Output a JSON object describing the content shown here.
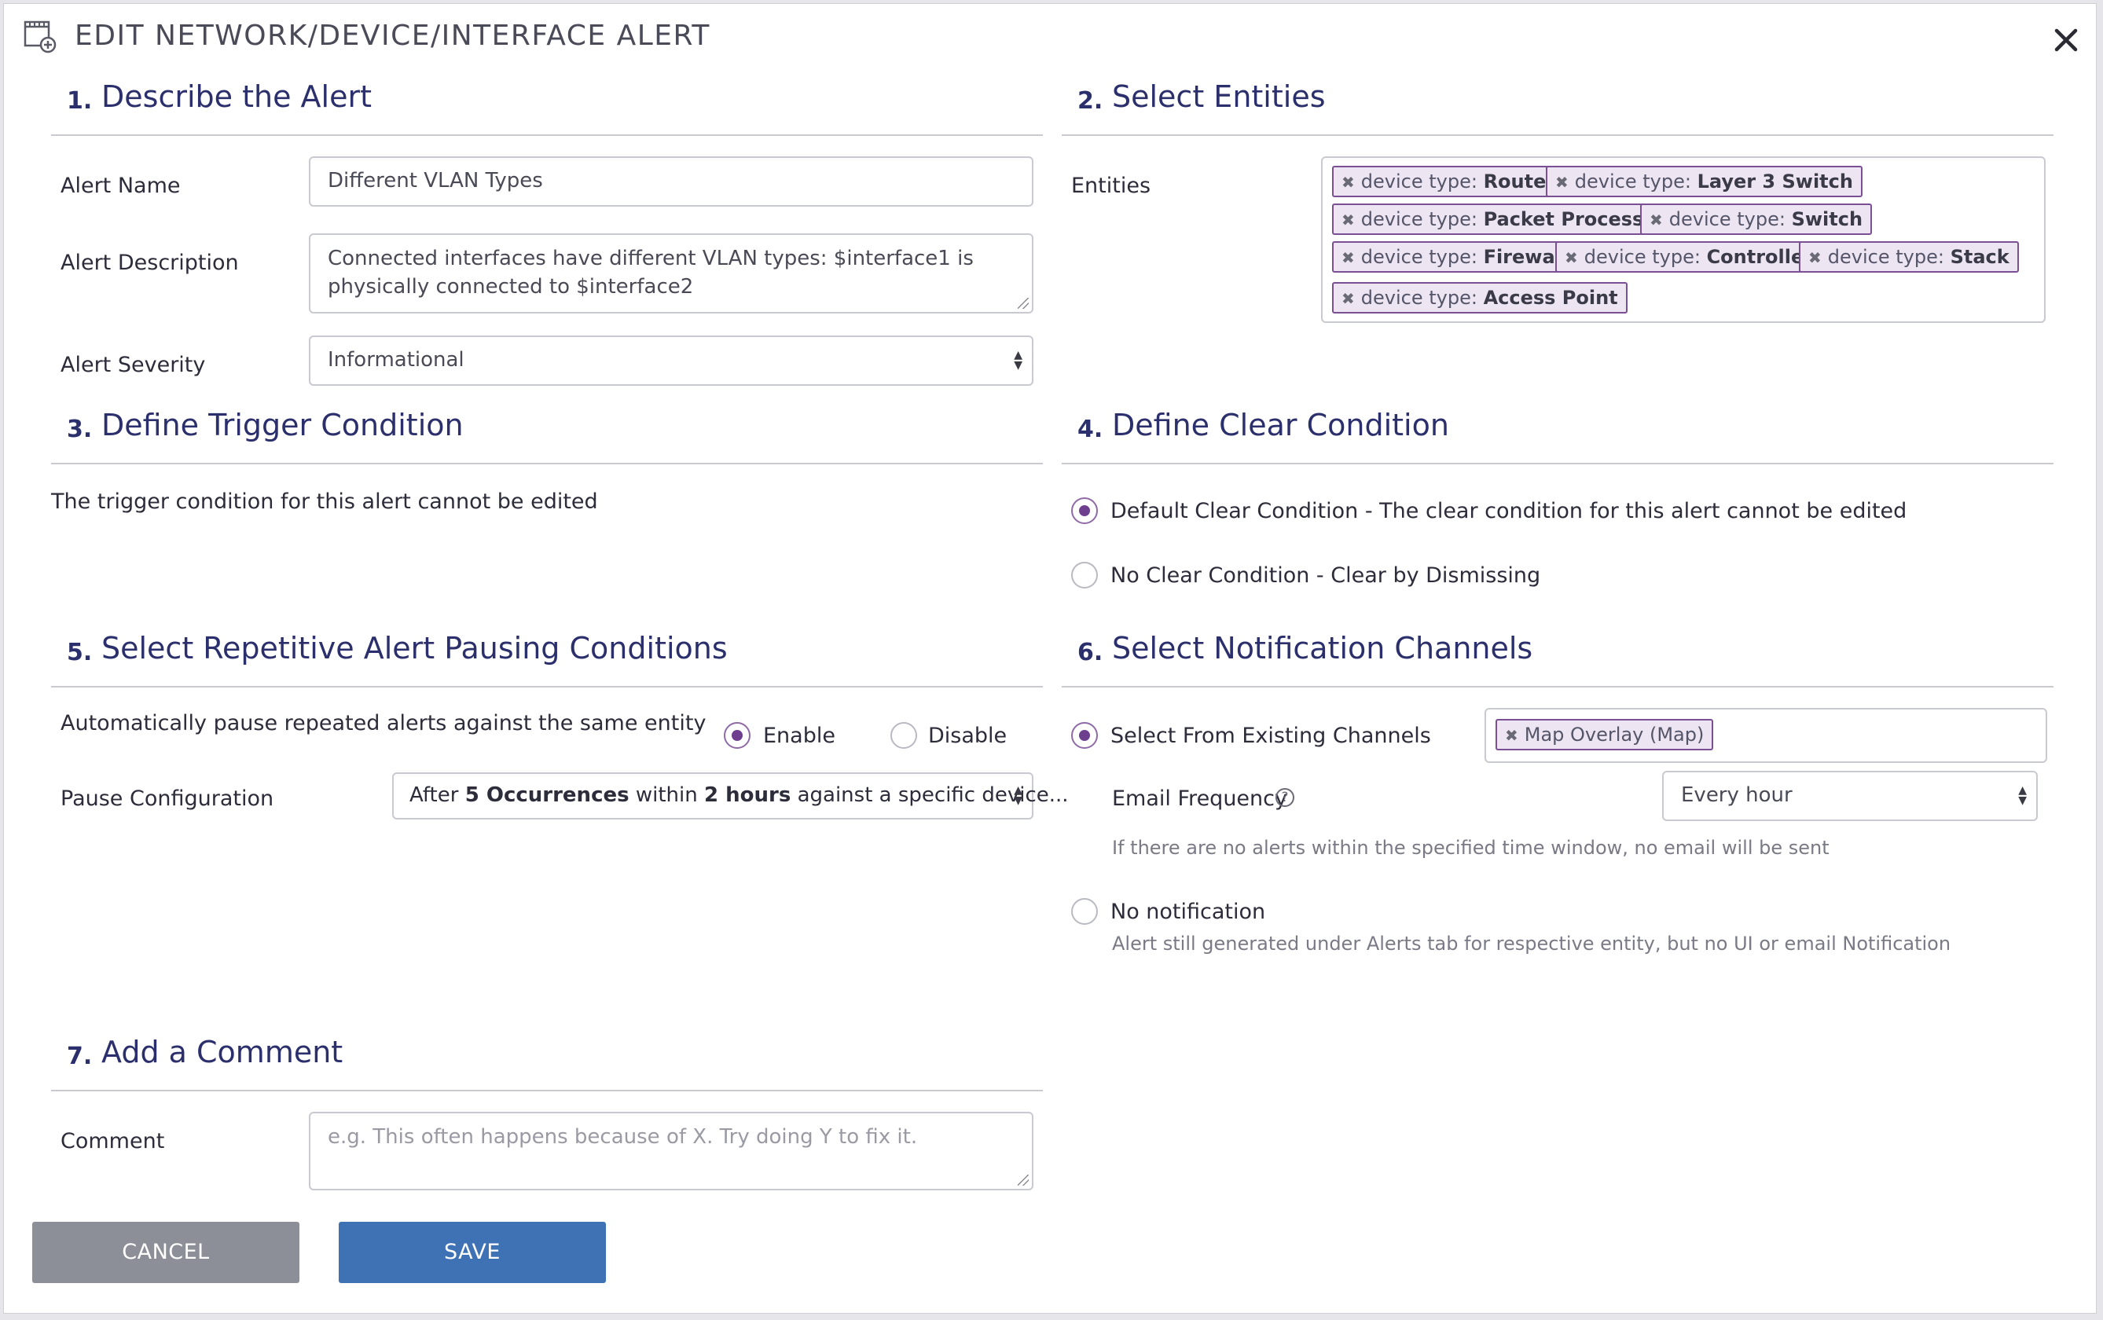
{
  "dialog": {
    "title": "EDIT NETWORK/DEVICE/INTERFACE ALERT",
    "close_icon": "close-icon",
    "title_icon": "add-alert-icon"
  },
  "sections": {
    "s1": {
      "num": "1.",
      "title": "Describe the Alert"
    },
    "s2": {
      "num": "2.",
      "title": "Select Entities"
    },
    "s3": {
      "num": "3.",
      "title": "Define Trigger Condition"
    },
    "s4": {
      "num": "4.",
      "title": "Define Clear Condition"
    },
    "s5": {
      "num": "5.",
      "title": "Select Repetitive Alert Pausing Conditions"
    },
    "s6": {
      "num": "6.",
      "title": "Select Notification Channels"
    },
    "s7": {
      "num": "7.",
      "title": "Add a Comment"
    }
  },
  "describe": {
    "name_label": "Alert Name",
    "name_value": "Different VLAN Types",
    "description_label": "Alert Description",
    "description_value": "Connected interfaces have different VLAN types: $interface1 is physically connected to $interface2",
    "severity_label": "Alert Severity",
    "severity_value": "Informational"
  },
  "entities": {
    "label": "Entities",
    "prefix": "device type: ",
    "tags": [
      "Router",
      "Layer 3 Switch",
      "Packet Processor",
      "Switch",
      "Firewall",
      "Controller",
      "Stack",
      "Access Point"
    ]
  },
  "trigger": {
    "text": "The trigger condition for this alert cannot be edited"
  },
  "clear": {
    "default_label": "Default Clear Condition - The clear condition for this alert cannot be edited",
    "default_selected": true,
    "none_label": "No Clear Condition - Clear by Dismissing",
    "none_selected": false
  },
  "pausing": {
    "auto_label": "Automatically pause repeated alerts against the same entity",
    "enable_label": "Enable",
    "enable_selected": true,
    "disable_label": "Disable",
    "disable_selected": false,
    "config_label": "Pause Configuration",
    "config_pre": "After ",
    "config_occ": "5 Occurrences",
    "config_mid": " within ",
    "config_hours": "2 hours",
    "config_post": " against a specific device..."
  },
  "notifications": {
    "existing_label": "Select From Existing Channels",
    "existing_selected": true,
    "channel_tags": [
      "Map Overlay (Map)"
    ],
    "email_freq_label": "Email Frequency",
    "help_glyph": "?",
    "email_freq_value": "Every hour",
    "email_freq_hint": "If there are no alerts within the specified time window, no email will be sent",
    "none_label": "No notification",
    "none_selected": false,
    "none_hint": "Alert still generated under Alerts tab for respective entity, but no UI or email Notification"
  },
  "comment": {
    "label": "Comment",
    "placeholder": "e.g. This often happens because of X. Try doing Y to fix it."
  },
  "buttons": {
    "cancel": "CANCEL",
    "save": "SAVE"
  },
  "colors": {
    "heading": "#2b2f6b",
    "accent_purple": "#6e3f8e",
    "tag_bg": "#ede6f2",
    "save_blue": "#3f72b5",
    "cancel_gray": "#8d8f98"
  }
}
